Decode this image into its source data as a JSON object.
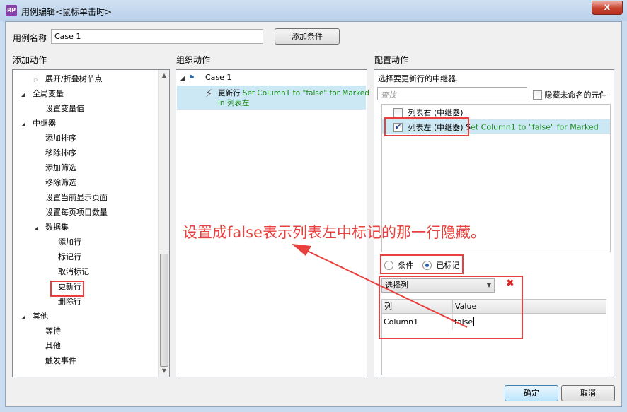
{
  "window": {
    "title": "用例编辑<鼠标单击时>",
    "app_icon_text": "RP",
    "close_glyph": "x"
  },
  "case_name": {
    "label": "用例名称",
    "value": "Case 1",
    "add_condition_label": "添加条件"
  },
  "columns": {
    "add_action": "添加动作",
    "organize_action": "组织动作",
    "configure_action": "配置动作"
  },
  "action_tree": [
    {
      "label": "展开/折叠树节点",
      "level": 1,
      "toggle": "collapsed"
    },
    {
      "label": "全局变量",
      "level": 0,
      "toggle": "expanded"
    },
    {
      "label": "设置变量值",
      "level": 1,
      "toggle": "none"
    },
    {
      "label": "中继器",
      "level": 0,
      "toggle": "expanded"
    },
    {
      "label": "添加排序",
      "level": 1,
      "toggle": "none"
    },
    {
      "label": "移除排序",
      "level": 1,
      "toggle": "none"
    },
    {
      "label": "添加筛选",
      "level": 1,
      "toggle": "none"
    },
    {
      "label": "移除筛选",
      "level": 1,
      "toggle": "none"
    },
    {
      "label": "设置当前显示页面",
      "level": 1,
      "toggle": "none"
    },
    {
      "label": "设置每页项目数量",
      "level": 1,
      "toggle": "none"
    },
    {
      "label": "数据集",
      "level": 1,
      "toggle": "expanded"
    },
    {
      "label": "添加行",
      "level": 2,
      "toggle": "none"
    },
    {
      "label": "标记行",
      "level": 2,
      "toggle": "none"
    },
    {
      "label": "取消标记",
      "level": 2,
      "toggle": "none"
    },
    {
      "label": "更新行",
      "level": 2,
      "toggle": "none",
      "highlighted": true
    },
    {
      "label": "删除行",
      "level": 2,
      "toggle": "none"
    },
    {
      "label": "其他",
      "level": 0,
      "toggle": "expanded"
    },
    {
      "label": "等待",
      "level": 1,
      "toggle": "none"
    },
    {
      "label": "其他",
      "level": 1,
      "toggle": "none"
    },
    {
      "label": "触发事件",
      "level": 1,
      "toggle": "none"
    }
  ],
  "organize": {
    "case_label": "Case 1",
    "action_name": "更新行",
    "action_detail_1": "Set Column1 to \"false\" for Marked",
    "action_detail_2": "in 列表左"
  },
  "configure": {
    "select_prompt": "选择要更新行的中继器.",
    "search_placeholder": "查找",
    "hide_unnamed_label": "隐藏未命名的元件",
    "repeaters": [
      {
        "label": "列表右 (中继器)",
        "checked": false,
        "detail": ""
      },
      {
        "label": "列表左 (中继器)",
        "checked": true,
        "detail": "Set Column1 to \"false\" for Marked"
      }
    ],
    "detail_prefix": "S",
    "detail_rest": "et Column1 to \"false\" for Marked",
    "radio_condition": "条件",
    "radio_marked": "已标记",
    "select_column": "选择列",
    "delete_glyph": "✖",
    "grid": {
      "headers": [
        "列",
        "Value"
      ],
      "rows": [
        [
          "Column1",
          "false"
        ]
      ]
    }
  },
  "footer": {
    "ok_label": "确定",
    "cancel_label": "取消"
  },
  "annotation": "设置成false表示列表左中标记的那一行隐藏。",
  "colors": {
    "highlight": "#e8403e",
    "selection": "#cde8f5",
    "action_text": "#1a8a1a"
  }
}
